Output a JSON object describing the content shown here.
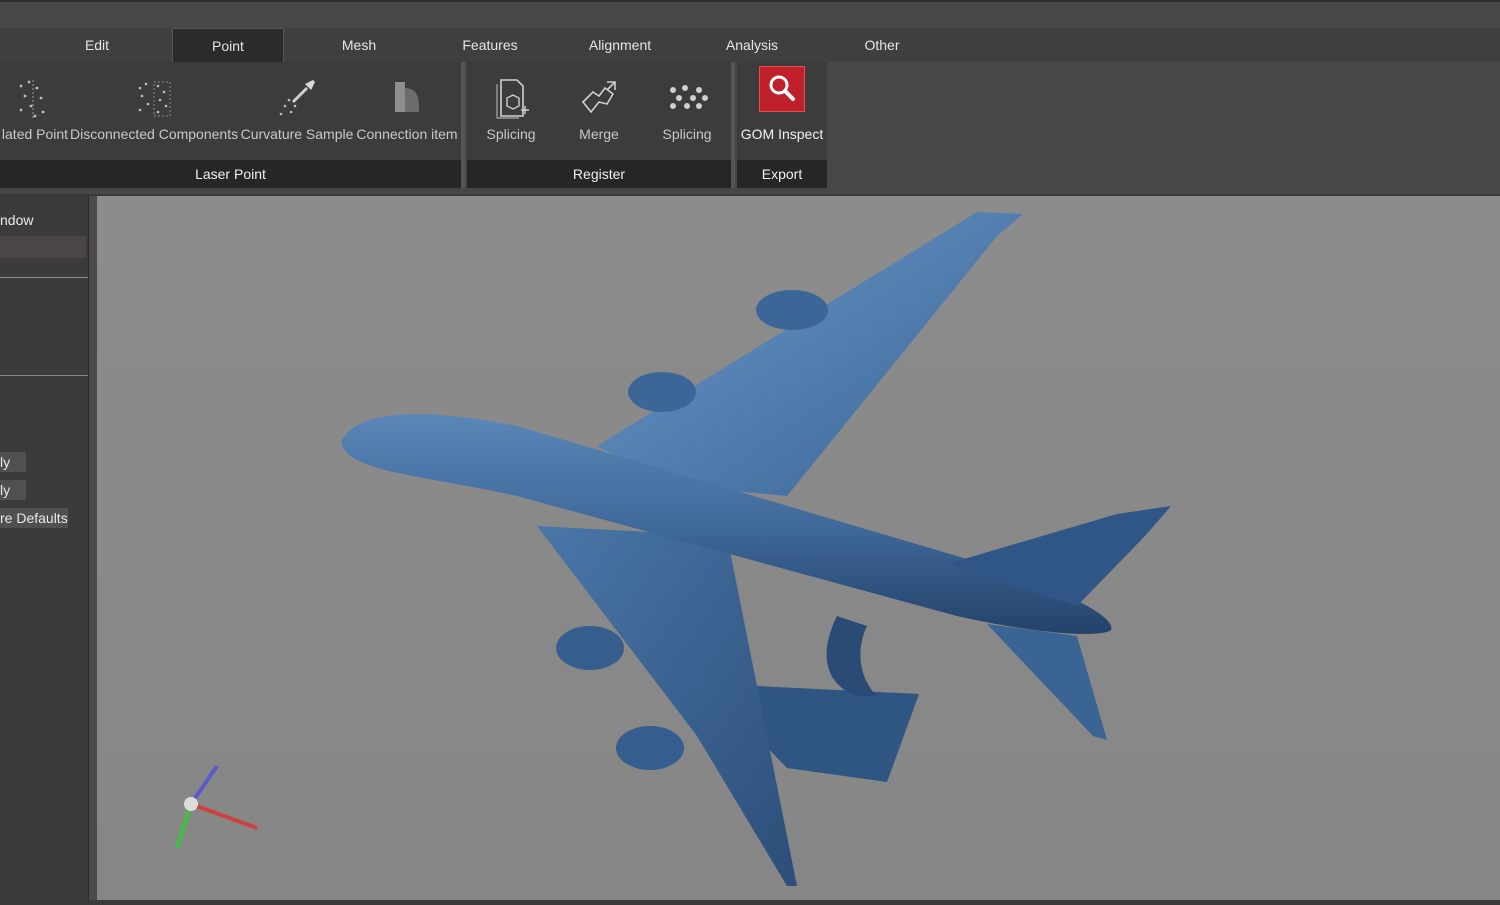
{
  "tabs": [
    {
      "label": "Edit"
    },
    {
      "label": "Point"
    },
    {
      "label": "Mesh"
    },
    {
      "label": "Features"
    },
    {
      "label": "Alignment"
    },
    {
      "label": "Analysis"
    },
    {
      "label": "Other"
    }
  ],
  "active_tab": "Point",
  "groups": {
    "laser_point": {
      "label": "Laser Point",
      "tools": [
        {
          "label": "lated Point",
          "icon": "isolated-point-icon"
        },
        {
          "label": "Disconnected Components",
          "icon": "disconnected-components-icon"
        },
        {
          "label": "Curvature Sample",
          "icon": "curvature-sample-icon"
        },
        {
          "label": "Connection item",
          "icon": "connection-item-icon"
        }
      ]
    },
    "register": {
      "label": "Register",
      "tools": [
        {
          "label": "Splicing",
          "icon": "splicing-doc-icon"
        },
        {
          "label": "Merge",
          "icon": "merge-icon"
        },
        {
          "label": "Splicing",
          "icon": "splicing-dots-icon"
        }
      ]
    },
    "export": {
      "label": "Export",
      "tools": [
        {
          "label": "GOM Inspect",
          "icon": "magnifier-icon"
        }
      ]
    }
  },
  "sidebar": {
    "header": "ndow",
    "buttons": [
      {
        "label": "ly"
      },
      {
        "label": "ly"
      },
      {
        "label": "re Defaults"
      }
    ]
  },
  "colors": {
    "accent_red": "#c0202a",
    "model_blue": "#3f6a9a",
    "viewport": "#888888"
  }
}
